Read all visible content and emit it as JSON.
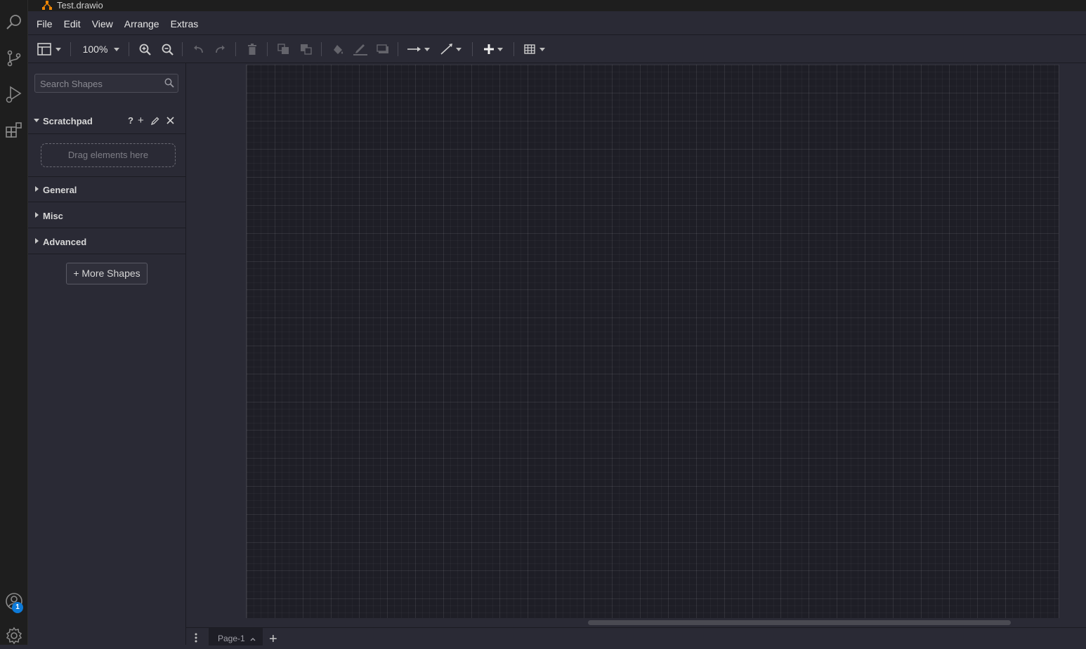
{
  "window": {
    "title": "Test.drawio"
  },
  "activity_bar": {
    "items": [
      {
        "icon": "search-icon"
      },
      {
        "icon": "source-control-icon"
      },
      {
        "icon": "run-debug-icon"
      },
      {
        "icon": "extensions-icon"
      }
    ],
    "bottom": [
      {
        "icon": "account-icon",
        "badge": "1"
      },
      {
        "icon": "settings-gear-icon"
      }
    ]
  },
  "menu": {
    "items": [
      "File",
      "Edit",
      "View",
      "Arrange",
      "Extras"
    ]
  },
  "toolbar": {
    "zoom": "100%",
    "tools": [
      "format-panel-icon",
      "zoom-in-icon",
      "zoom-out-icon",
      "undo-icon",
      "redo-icon",
      "delete-icon",
      "to-front-icon",
      "to-back-icon",
      "fill-color-icon",
      "line-color-icon",
      "shadow-icon",
      "connection-icon",
      "waypoints-icon",
      "insert-icon",
      "table-icon"
    ]
  },
  "sidebar": {
    "search_placeholder": "Search Shapes",
    "scratchpad": {
      "title": "Scratchpad",
      "help": "?",
      "add": "+",
      "drop_hint": "Drag elements here"
    },
    "sections": [
      "General",
      "Misc",
      "Advanced"
    ],
    "more_shapes": "+ More Shapes"
  },
  "pages": {
    "tabs": [
      "Page-1"
    ],
    "add": "+"
  },
  "colors": {
    "background": "#2a2a35",
    "canvas": "#1e1e26",
    "accent": "#0d7ad8",
    "logo": "#f08705"
  }
}
